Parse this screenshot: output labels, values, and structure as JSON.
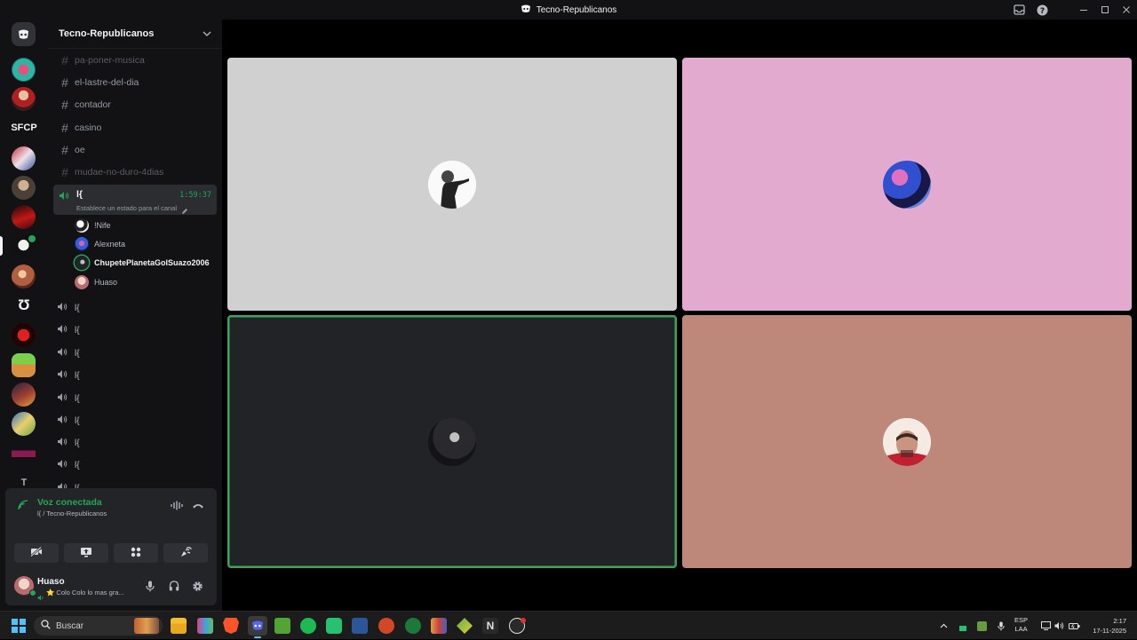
{
  "window": {
    "title": "Tecno-Republicanos"
  },
  "rail": {
    "servers": [
      {
        "name": "server-1"
      },
      {
        "name": "server-2"
      },
      {
        "label": "SFCP"
      },
      {
        "name": "server-4"
      },
      {
        "name": "server-5"
      },
      {
        "name": "server-6"
      },
      {
        "name": "server-active"
      },
      {
        "name": "server-8"
      },
      {
        "label": "Ʊ"
      },
      {
        "name": "server-10"
      },
      {
        "name": "server-11"
      },
      {
        "name": "server-12"
      },
      {
        "name": "server-13"
      },
      {
        "name": "server-14"
      },
      {
        "label": "T"
      }
    ]
  },
  "guild": {
    "name": "Tecno-Republicanos"
  },
  "channels": [
    {
      "name": "pa-poner-musica",
      "muted": true
    },
    {
      "name": "el-lastre-del-dia",
      "muted": false
    },
    {
      "name": "contador",
      "muted": false
    },
    {
      "name": "casino",
      "muted": false
    },
    {
      "name": "oe",
      "muted": false
    },
    {
      "name": "mudae-no-duro-4dias",
      "muted": true
    }
  ],
  "active_voice": {
    "name": "l{",
    "timer": "1:59:37",
    "status": "Establece un estado para el canal"
  },
  "members": [
    "!Nife",
    "Alexneta",
    "ChupetePlanetaGolSuazo2006",
    "Huaso"
  ],
  "voice_channels": [
    "l{",
    "l{",
    "l{",
    "l{",
    "l{",
    "l{",
    "l{",
    "l{",
    "l{"
  ],
  "voice_panel": {
    "title": "Voz conectada",
    "subtitle": "l{ / Tecno-Republicanos"
  },
  "user": {
    "name": "Huaso",
    "status": "⭐ Colo Colo lo mas gra..."
  },
  "taskbar": {
    "search_placeholder": "Buscar",
    "lang_top": "ESP",
    "lang_bottom": "LAA",
    "time": "2:17",
    "date": "17-11-2025"
  },
  "colors": {
    "accent_green": "#23a55a",
    "tile_1": "#d0d0d0",
    "tile_2": "#e2aacf",
    "tile_3": "#222326",
    "tile_4": "#bd8779"
  }
}
